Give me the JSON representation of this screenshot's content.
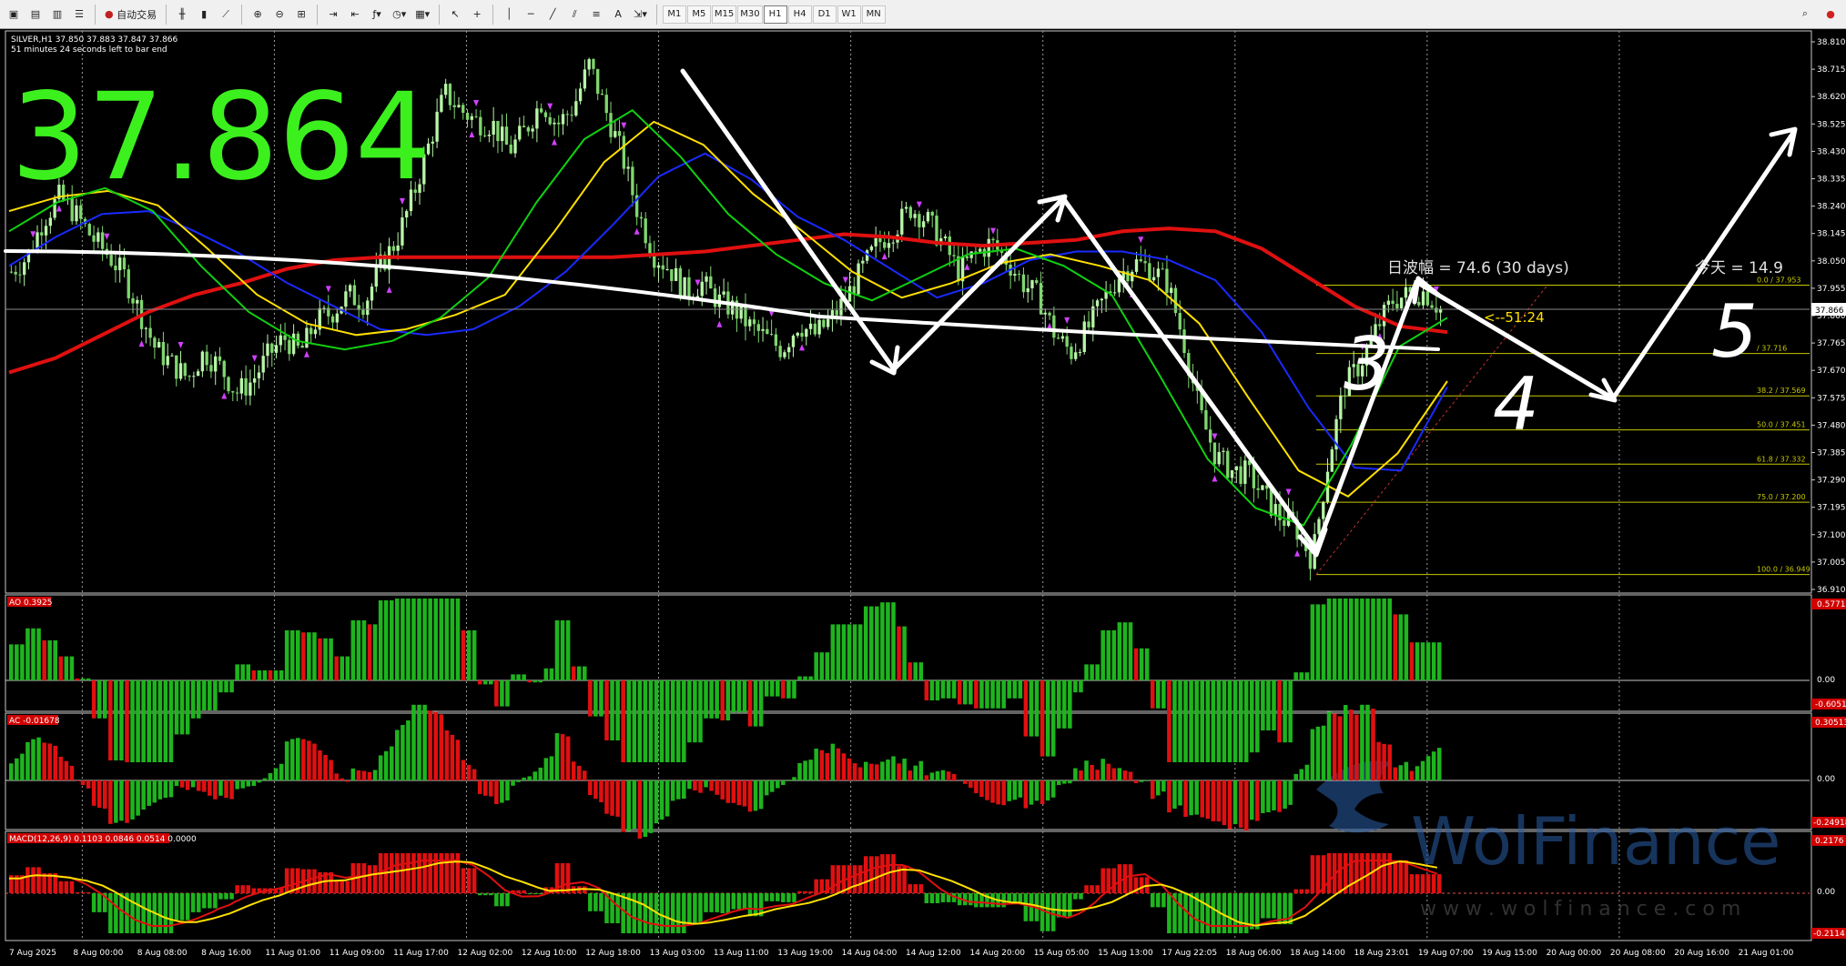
{
  "toolbar": {
    "autotrade_label": "自动交易",
    "timeframes": [
      "M1",
      "M5",
      "M15",
      "M30",
      "H1",
      "H4",
      "D1",
      "W1",
      "MN"
    ],
    "active_timeframe": "H1"
  },
  "chart_header": {
    "symbol_line": "SILVER,H1  37.850 37.883 37.847 37.866",
    "timer_line": "51 minutes 24 seconds left to bar end",
    "big_price": "37.864"
  },
  "price_axis": {
    "labels": [
      "38.810",
      "38.715",
      "38.620",
      "38.525",
      "38.430",
      "38.335",
      "38.240",
      "38.145",
      "38.050",
      "37.955",
      "37.860",
      "37.765",
      "37.670",
      "37.575",
      "37.480",
      "37.385",
      "37.290",
      "37.195",
      "37.100",
      "37.005",
      "36.910"
    ],
    "current_price": "37.866"
  },
  "time_axis": {
    "labels": [
      "7 Aug 2025",
      "8 Aug 00:00",
      "8 Aug 08:00",
      "8 Aug 16:00",
      "11 Aug 01:00",
      "11 Aug 09:00",
      "11 Aug 17:00",
      "12 Aug 02:00",
      "12 Aug 10:00",
      "12 Aug 18:00",
      "13 Aug 03:00",
      "13 Aug 11:00",
      "13 Aug 19:00",
      "14 Aug 04:00",
      "14 Aug 12:00",
      "14 Aug 20:00",
      "15 Aug 05:00",
      "15 Aug 13:00",
      "17 Aug 22:05",
      "18 Aug 06:00",
      "18 Aug 14:00",
      "18 Aug 23:01",
      "19 Aug 07:00",
      "19 Aug 15:00",
      "20 Aug 00:00",
      "20 Aug 08:00",
      "20 Aug 16:00",
      "21 Aug 01:00"
    ]
  },
  "annotations": {
    "daily_range": "日波幅 = 74.6  (30 days)",
    "today": "今天 = 14.9",
    "countdown": "<--51:24",
    "wave_labels": [
      "3",
      "4",
      "5"
    ]
  },
  "fibonacci": [
    {
      "label": "0.0 / 37.953",
      "price": 37.953
    },
    {
      "label": "/ 37.716",
      "price": 37.716
    },
    {
      "label": "38.2 / 37.569",
      "price": 37.569
    },
    {
      "label": "50.0 / 37.451",
      "price": 37.451
    },
    {
      "label": "61.8 / 37.332",
      "price": 37.332
    },
    {
      "label": "75.0 / 37.200",
      "price": 37.2
    },
    {
      "label": "100.0 / 36.949",
      "price": 36.949
    }
  ],
  "indicators": {
    "ao": {
      "label": "AO 0.3925",
      "top": "0.5771",
      "zero": "0.00",
      "bottom": "-0.6051"
    },
    "ac": {
      "label": "AC -0.01678",
      "top": "0.30513",
      "zero": "0.00",
      "bottom": "-0.24918"
    },
    "macd": {
      "label": "MACD(12,26,9) 0.1103 0.0846 0.0514 0.0000",
      "top": "0.2176",
      "zero": "0.00",
      "bottom": "-0.2114"
    }
  },
  "watermark": {
    "brand": "WolFinance",
    "url": "w w w . w o l f i n a n c e . c o m"
  },
  "colors": {
    "background": "#000000",
    "bull_candle": "#b8f5a8",
    "bear_candle": "#7fd66e",
    "ma_red": "#e01010",
    "ma_yellow": "#ffe000",
    "ma_green": "#10d010",
    "ma_blue": "#1a2aff",
    "big_price": "#3cf01e",
    "fib": "#c8c800",
    "hist_up": "#1eb41e",
    "hist_down": "#e01010"
  },
  "chart_data": {
    "type": "candlestick",
    "title": "SILVER,H1",
    "price_range": [
      36.91,
      38.81
    ],
    "current": 37.866,
    "ohlc_last": {
      "open": 37.85,
      "high": 37.883,
      "low": 37.847,
      "close": 37.866
    },
    "path_prices": [
      38.0,
      38.05,
      38.18,
      38.26,
      38.2,
      38.12,
      38.06,
      37.99,
      37.86,
      37.73,
      37.68,
      37.63,
      37.72,
      37.67,
      37.58,
      37.62,
      37.71,
      37.77,
      37.72,
      37.83,
      37.86,
      37.92,
      37.89,
      38.02,
      38.11,
      38.26,
      38.44,
      38.62,
      38.56,
      38.52,
      38.51,
      38.42,
      38.49,
      38.59,
      38.51,
      38.57,
      38.72,
      38.56,
      38.41,
      38.21,
      38.06,
      38.01,
      37.93,
      37.96,
      37.9,
      37.87,
      37.81,
      37.77,
      37.73,
      37.82,
      37.78,
      37.83,
      37.91,
      38.01,
      38.1,
      38.15,
      38.22,
      38.18,
      38.1,
      38.0,
      38.06,
      38.1,
      38.04,
      37.96,
      37.91,
      37.78,
      37.72,
      37.8,
      37.9,
      37.99,
      38.03,
      38.01,
      37.96,
      37.76,
      37.51,
      37.36,
      37.31,
      37.3,
      37.22,
      37.15,
      37.11,
      37.0,
      37.34,
      37.6,
      37.68,
      37.8,
      37.9,
      37.92,
      37.93,
      37.87
    ],
    "moving_averages": [
      {
        "color": "red",
        "prices": [
          37.65,
          37.7,
          37.78,
          37.86,
          37.92,
          37.96,
          38.01,
          38.04,
          38.05,
          38.05,
          38.05,
          38.05,
          38.05,
          38.05,
          38.06,
          38.07,
          38.09,
          38.11,
          38.13,
          38.12,
          38.1,
          38.09,
          38.1,
          38.11,
          38.14,
          38.15,
          38.14,
          38.08,
          37.98,
          37.88,
          37.81,
          37.79
        ]
      },
      {
        "color": "blue",
        "prices": [
          38.02,
          38.12,
          38.2,
          38.21,
          38.14,
          38.06,
          37.96,
          37.88,
          37.8,
          37.78,
          37.8,
          37.88,
          38.0,
          38.16,
          38.33,
          38.41,
          38.32,
          38.19,
          38.11,
          38.01,
          37.91,
          37.96,
          38.04,
          38.07,
          38.07,
          38.04,
          37.97,
          37.79,
          37.53,
          37.32,
          37.31,
          37.6
        ]
      },
      {
        "color": "yellow",
        "prices": [
          38.21,
          38.26,
          38.28,
          38.23,
          38.08,
          37.92,
          37.82,
          37.78,
          37.8,
          37.85,
          37.92,
          38.14,
          38.38,
          38.52,
          38.44,
          38.27,
          38.14,
          38.0,
          37.91,
          37.96,
          38.03,
          38.06,
          38.02,
          37.97,
          37.82,
          37.56,
          37.31,
          37.22,
          37.37,
          37.62
        ]
      },
      {
        "color": "green",
        "prices": [
          38.14,
          38.24,
          38.29,
          38.21,
          38.02,
          37.86,
          37.76,
          37.73,
          37.76,
          37.84,
          37.98,
          38.24,
          38.46,
          38.56,
          38.4,
          38.2,
          38.06,
          37.96,
          37.9,
          37.98,
          38.06,
          38.08,
          38.02,
          37.92,
          37.64,
          37.35,
          37.18,
          37.12,
          37.4,
          37.74,
          37.84
        ]
      }
    ]
  }
}
